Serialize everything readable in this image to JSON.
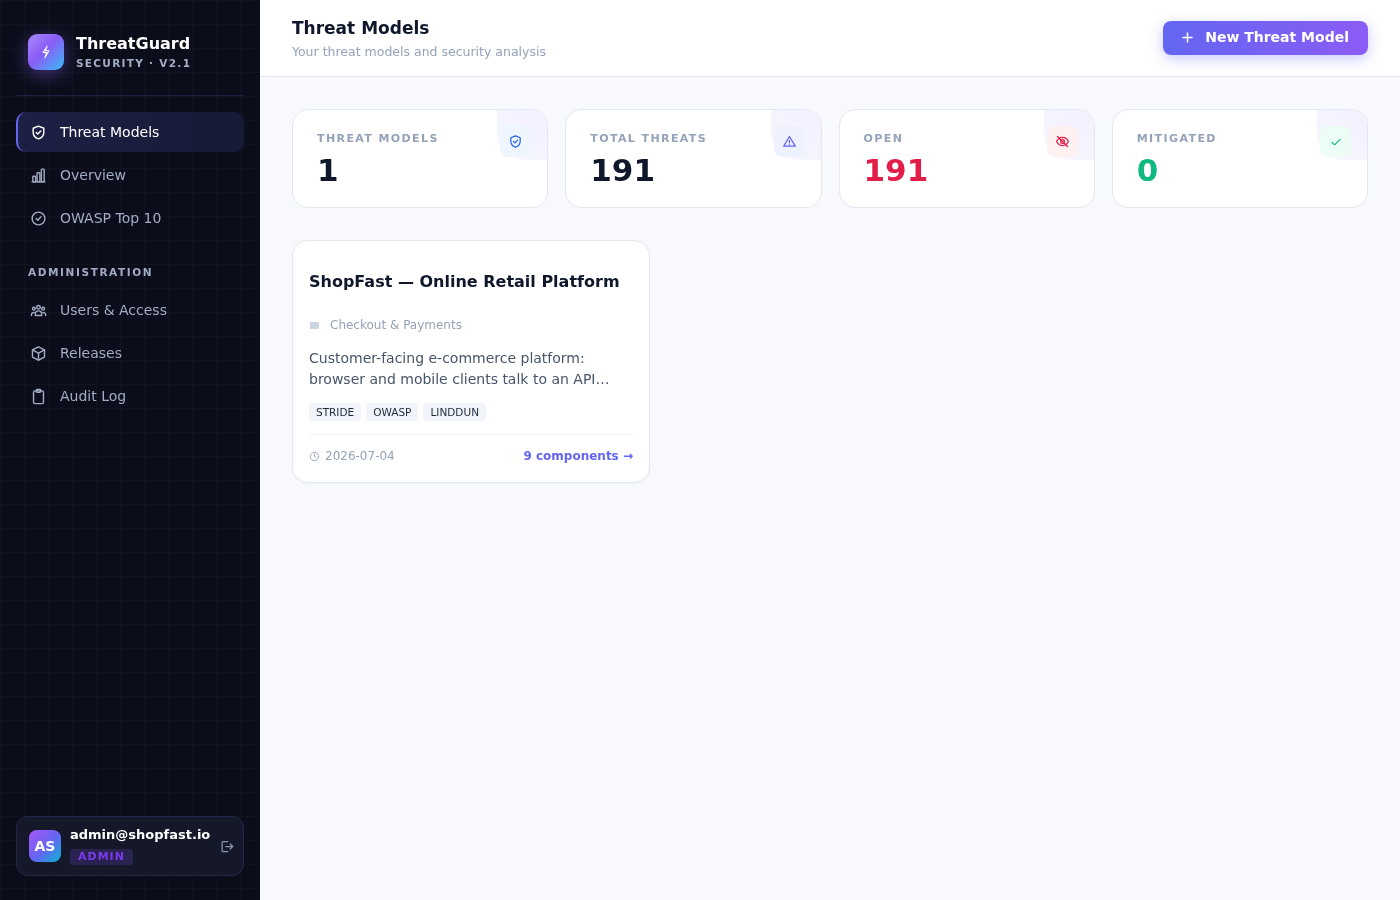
{
  "sidebar": {
    "brand": {
      "name": "ThreatGuard",
      "tagline": "SECURITY · V2.1"
    },
    "nav": [
      {
        "label": "Threat Models",
        "selected": true
      },
      {
        "label": "Overview",
        "selected": false
      },
      {
        "label": "OWASP Top 10",
        "selected": false
      }
    ],
    "sections": [
      {
        "heading": "ADMINISTRATION",
        "items": [
          {
            "label": "Users & Access",
            "selected": false
          },
          {
            "label": "Releases",
            "selected": false
          },
          {
            "label": "Audit Log",
            "selected": false
          }
        ]
      }
    ],
    "user": {
      "initials": "AS",
      "email": "admin@shopfast.io",
      "role": "ADMIN"
    }
  },
  "header": {
    "title": "Threat Models",
    "subtitle": "Your threat models and security analysis",
    "action": "New Threat Model"
  },
  "stats": [
    {
      "kind": "models",
      "label": "THREAT MODELS",
      "value": "1",
      "color": "#0f172a"
    },
    {
      "kind": "threats",
      "label": "TOTAL THREATS",
      "value": "191",
      "color": "#0f172a"
    },
    {
      "kind": "open",
      "label": "OPEN",
      "value": "191",
      "color": "#e11d48"
    },
    {
      "kind": "mitigated",
      "label": "MITIGATED",
      "value": "0",
      "color": "#10b981"
    }
  ],
  "models": [
    {
      "title": "ShopFast — Online Retail Platform",
      "category": "Checkout & Payments",
      "description": "Customer-facing e-commerce platform: browser and mobile clients talk to an API…",
      "tags": [
        "STRIDE",
        "OWASP",
        "LINDDUN"
      ],
      "date": "2026-07-04",
      "components": "9 components →"
    }
  ]
}
